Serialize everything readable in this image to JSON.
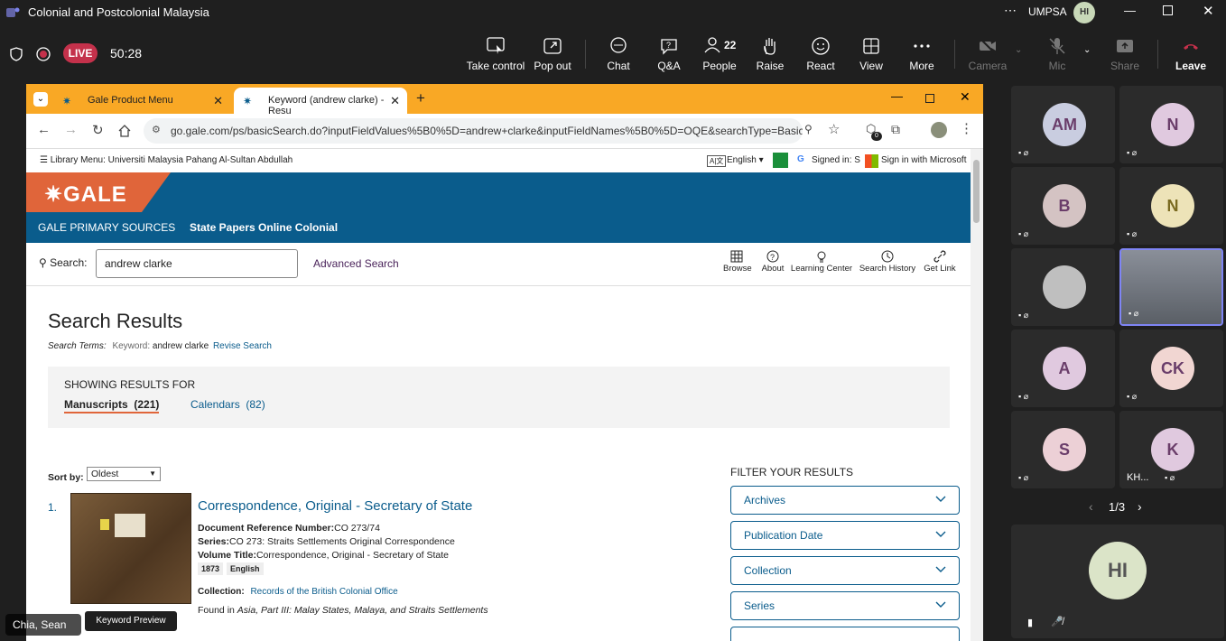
{
  "teams": {
    "title": "Colonial and Postcolonial Malaysia",
    "org": "UMPSA",
    "user_initials": "HI",
    "live_label": "LIVE",
    "timer": "50:28",
    "buttons": [
      {
        "label": "Take control"
      },
      {
        "label": "Pop out"
      },
      {
        "label": "Chat"
      },
      {
        "label": "Q&A"
      },
      {
        "label": "People"
      },
      {
        "label": "Raise"
      },
      {
        "label": "React"
      },
      {
        "label": "View"
      },
      {
        "label": "More"
      },
      {
        "label": "Camera"
      },
      {
        "label": "Mic"
      },
      {
        "label": "Share"
      },
      {
        "label": "Leave"
      }
    ],
    "people_count": "22",
    "presenter_name": "Chia, Sean",
    "keyword_preview": "Keyword Preview"
  },
  "browser": {
    "tabs": [
      {
        "title": "Gale Product Menu"
      },
      {
        "title": "Keyword (andrew clarke) - Resu"
      }
    ],
    "url": "go.gale.com/ps/basicSearch.do?inputFieldValues%5B0%5D=andrew+clarke&inputFieldNames%5B0%5D=OQE&searchType=BasicSea...",
    "ext_badge": "0"
  },
  "gale": {
    "library_menu": "Library Menu: Universiti Malaysia Pahang Al-Sultan Abdullah",
    "language": "English",
    "signed_in": "Signed in: S",
    "microsoft": "Sign in with Microsoft",
    "logo": "GALE",
    "primary_sources": "GALE PRIMARY SOURCES",
    "collection": "State Papers Online Colonial",
    "search_label": "Search:",
    "search_value": "andrew clarke",
    "advanced": "Advanced Search",
    "quick_links": [
      {
        "label": "Browse"
      },
      {
        "label": "About"
      },
      {
        "label": "Learning Center"
      },
      {
        "label": "Search History"
      },
      {
        "label": "Get Link"
      }
    ],
    "results_title": "Search Results",
    "search_terms_label": "Search Terms:",
    "search_terms_keyword": "Keyword:",
    "search_terms_value": "andrew clarke",
    "revise": "Revise Search",
    "showing": "SHOWING RESULTS FOR",
    "tab_manuscripts": "Manuscripts  (221)",
    "tab_calendars": "Calendars  (82)",
    "sort_label": "Sort by:",
    "sort_value": "Oldest",
    "result": {
      "num": "1.",
      "title": "Correspondence, Original - Secretary of State",
      "ref_label": "Document Reference Number:",
      "ref_value": "CO 273/74",
      "series_label": "Series:",
      "series_value": "CO 273: Straits Settlements Original Correspondence",
      "volume_label": "Volume Title:",
      "volume_value": "Correspondence, Original - Secretary of State",
      "year": "1873",
      "lang": "English",
      "collection_label": "Collection:",
      "collection_value": "Records of the British Colonial Office",
      "found_prefix": "Found in",
      "found_value": "Asia, Part III: Malay States, Malaya, and Straits Settlements"
    },
    "filter_title": "FILTER YOUR RESULTS",
    "filters": [
      {
        "label": "Archives"
      },
      {
        "label": "Publication Date"
      },
      {
        "label": "Collection"
      },
      {
        "label": "Series"
      }
    ]
  },
  "participants": [
    {
      "initials": "AM",
      "color": "#c9cde0"
    },
    {
      "initials": "N",
      "color": "#e0c9df"
    },
    {
      "initials": "B",
      "color": "#d4c3c3"
    },
    {
      "initials": "N",
      "color": "#ede3b8"
    },
    {
      "initials": "",
      "color": "#bfbfbf"
    },
    {
      "initials": "",
      "color": "#d9d9d9"
    },
    {
      "initials": "A",
      "color": "#e0c9df"
    },
    {
      "initials": "CK",
      "color": "#f1d6d2"
    },
    {
      "initials": "S",
      "color": "#ecd0d6"
    },
    {
      "initials": "K",
      "color": "#e0c9df"
    }
  ],
  "tile_name_kh": "KH...",
  "pager": "1/3",
  "self_initials": "HI"
}
